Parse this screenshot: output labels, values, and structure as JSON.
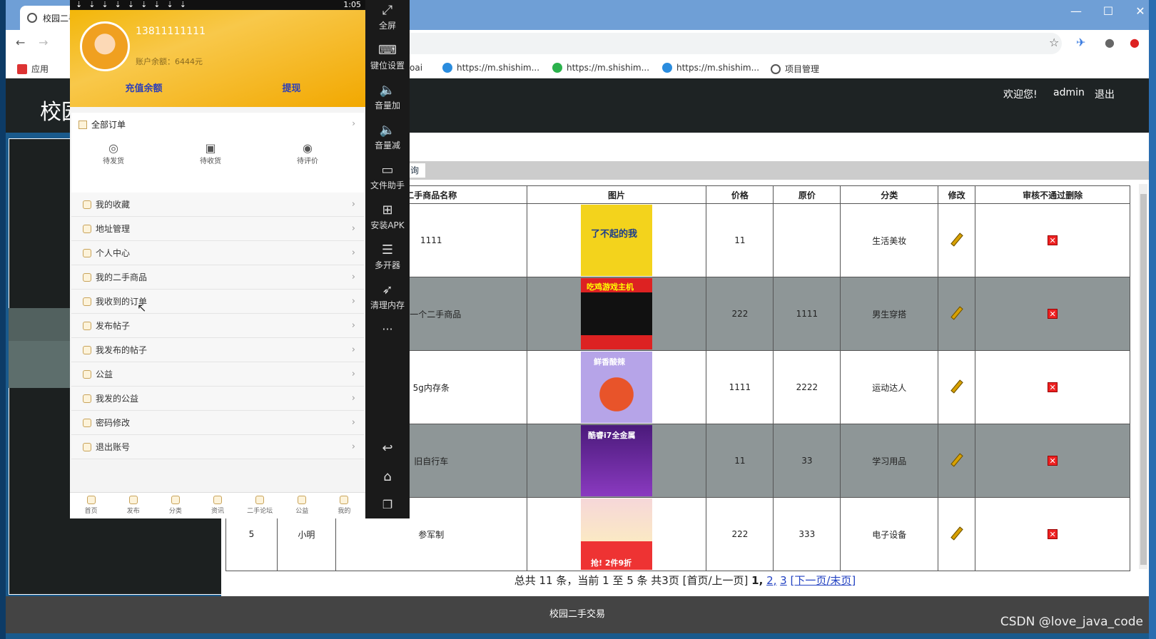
{
  "browser": {
    "tab_title": "校园二手",
    "bookmarks": [
      "应用",
      "oai",
      "https://m.shishim...",
      "https://m.shishim...",
      "https://m.shishim...",
      "项目管理"
    ],
    "window_controls": [
      "—",
      "☐",
      "✕"
    ]
  },
  "header": {
    "logo": "校园",
    "welcome": "欢迎您!",
    "user": "admin",
    "logout": "退出"
  },
  "query_button": "询",
  "table": {
    "headers": [
      "二手商品名称",
      "图片",
      "价格",
      "原价",
      "分类",
      "修改",
      "审核不通过删除"
    ],
    "rows": [
      {
        "id": "",
        "seller": "",
        "name": "1111",
        "price": "11",
        "orig": "",
        "cat": "生活美妆",
        "img_text": "了不起的我"
      },
      {
        "id": "",
        "seller": "",
        "name": "第一个二手商品",
        "price": "222",
        "orig": "1111",
        "cat": "男生穿搭",
        "img_text": "吃鸡游戏主机"
      },
      {
        "id": "",
        "seller": "",
        "name": "5g内存条",
        "price": "1111",
        "orig": "2222",
        "cat": "运动达人",
        "img_text": "鲜香酸辣"
      },
      {
        "id": "",
        "seller": "",
        "name": "旧自行车",
        "price": "11",
        "orig": "33",
        "cat": "学习用品",
        "img_text": "酷睿i7全金属"
      },
      {
        "id": "5",
        "seller": "小明",
        "name": "参军制",
        "price": "222",
        "orig": "333",
        "cat": "电子设备",
        "img_text": "抢! 2件9折"
      }
    ]
  },
  "pager": {
    "text": "总共 11 条，当前 1 至 5 条 共3页 [首页/上一页]",
    "current": "1,",
    "p2": "2,",
    "p3": "3",
    "next": "[下一页",
    "last": "/末页]"
  },
  "footer": "校园二手交易",
  "watermark": "CSDN @love_java_code",
  "phone": {
    "time": "1:05",
    "username": "13811111111",
    "balance": "账户余额：6444元",
    "recharge": "充值余额",
    "withdraw": "提现",
    "all_orders": "全部订单",
    "order_states": [
      "待发货",
      "待收货",
      "待评价"
    ],
    "menu": [
      "我的收藏",
      "地址管理",
      "个人中心",
      "我的二手商品",
      "我收到的订单",
      "发布帖子",
      "我发布的帖子",
      "公益",
      "我发的公益",
      "密码修改",
      "退出账号"
    ],
    "bottom_nav": [
      "首页",
      "发布",
      "分类",
      "资讯",
      "二手论坛",
      "公益",
      "我的"
    ]
  },
  "emulator_sidebar": [
    "全屏",
    "键位设置",
    "音量加",
    "音量减",
    "文件助手",
    "安装APK",
    "多开器",
    "清理内存"
  ]
}
